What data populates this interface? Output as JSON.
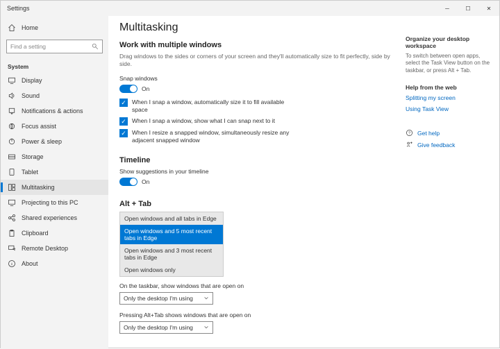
{
  "titlebar": {
    "title": "Settings"
  },
  "sidebar": {
    "home": "Home",
    "search_placeholder": "Find a setting",
    "section": "System",
    "items": [
      {
        "label": "Display"
      },
      {
        "label": "Sound"
      },
      {
        "label": "Notifications & actions"
      },
      {
        "label": "Focus assist"
      },
      {
        "label": "Power & sleep"
      },
      {
        "label": "Storage"
      },
      {
        "label": "Tablet"
      },
      {
        "label": "Multitasking"
      },
      {
        "label": "Projecting to this PC"
      },
      {
        "label": "Shared experiences"
      },
      {
        "label": "Clipboard"
      },
      {
        "label": "Remote Desktop"
      },
      {
        "label": "About"
      }
    ]
  },
  "content": {
    "title": "Multitasking",
    "ws_title": "Work with multiple windows",
    "ws_desc": "Drag windows to the sides or corners of your screen and they'll automatically size to fit perfectly, side by side.",
    "snap_label": "Snap windows",
    "on": "On",
    "snap_opts": [
      "When I snap a window, automatically size it to fill available space",
      "When I snap a window, show what I can snap next to it",
      "When I resize a snapped window, simultaneously resize any adjacent snapped window"
    ],
    "timeline_title": "Timeline",
    "timeline_label": "Show suggestions in your timeline",
    "alttab_title": "Alt + Tab",
    "alttab_opts": [
      "Open windows and all tabs in Edge",
      "Open windows and 5 most recent tabs in Edge",
      "Open windows and 3 most recent tabs in Edge",
      "Open windows only"
    ],
    "taskbar_label": "On the taskbar, show windows that are open on",
    "taskbar_value": "Only the desktop I'm using",
    "alttab2_label": "Pressing Alt+Tab shows windows that are open on",
    "alttab2_value": "Only the desktop I'm using"
  },
  "right": {
    "org_title": "Organize your desktop workspace",
    "org_text": "To switch between open apps, select the Task View button on the taskbar, or press Alt + Tab.",
    "web_title": "Help from the web",
    "link1": "Splitting my screen",
    "link2": "Using Task View",
    "help": "Get help",
    "feedback": "Give feedback"
  }
}
